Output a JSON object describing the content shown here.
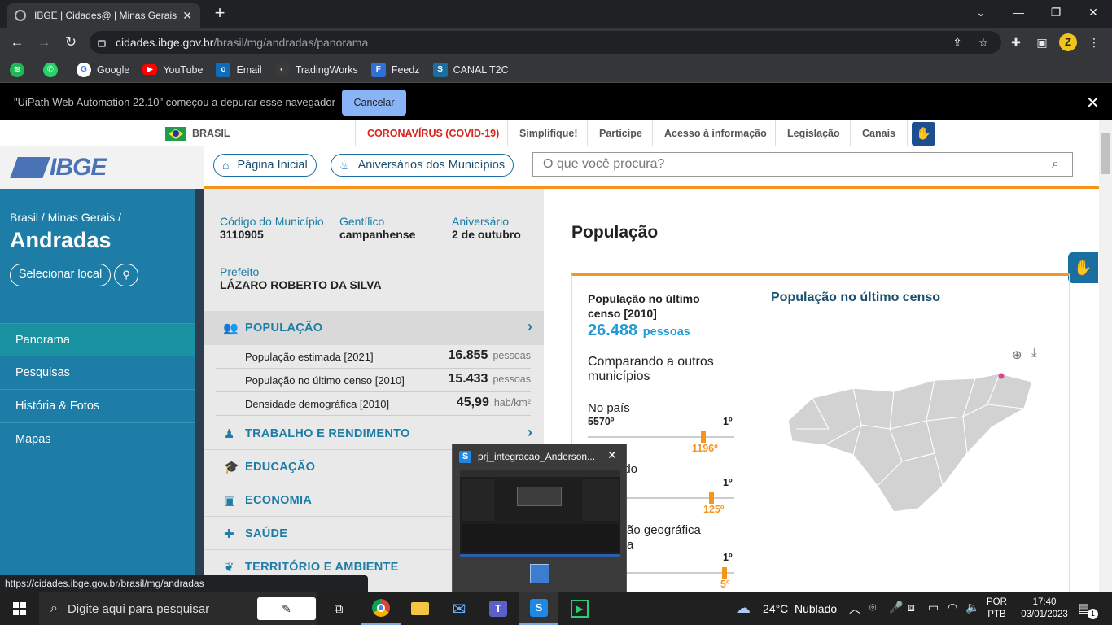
{
  "browser": {
    "tab_title": "IBGE | Cidades@ | Minas Gerais |",
    "tab_close": "✕",
    "new_tab": "+",
    "url_host": "cidades.ibge.gov.br",
    "url_path": "/brasil/mg/andradas/panorama",
    "profile_initial": "Z",
    "bookmarks": [
      "Google",
      "YouTube",
      "Email",
      "TradingWorks",
      "Feedz",
      "CANAL T2C"
    ],
    "infobar_message": "\"UiPath Web Automation 22.10\" começou a depurar esse navegador",
    "infobar_button": "Cancelar",
    "status_url": "https://cidades.ibge.gov.br/brasil/mg/andradas"
  },
  "govbar": {
    "brasil": "BRASIL",
    "links": [
      "CORONAVÍRUS (COVID-19)",
      "Simplifique!",
      "Participe",
      "Acesso à informação",
      "Legislação",
      "Canais"
    ]
  },
  "header": {
    "logo": "IBGE",
    "home_label": "Página Inicial",
    "anniv_label": "Aniversários dos Municípios",
    "search_placeholder": "O que você procura?"
  },
  "sidebar": {
    "breadcrumb": "Brasil / Minas Gerais /",
    "city": "Andradas",
    "select_label": "Selecionar local",
    "nav": [
      "Panorama",
      "Pesquisas",
      "História & Fotos",
      "Mapas"
    ]
  },
  "info": {
    "codigo_label": "Código do Município",
    "codigo_value": "3110905",
    "gentilico_label": "Gentílico",
    "gentilico_value": "campanhense",
    "aniversario_label": "Aniversário",
    "aniversario_value": "2 de outubro",
    "prefeito_label": "Prefeito",
    "prefeito_value": "LÁZARO ROBERTO DA SILVA"
  },
  "population_section": {
    "title": "POPULAÇÃO",
    "rows": [
      {
        "label": "População estimada [2021]",
        "value": "16.855",
        "unit": "pessoas"
      },
      {
        "label": "População no último censo [2010]",
        "value": "15.433",
        "unit": "pessoas"
      },
      {
        "label": "Densidade demográfica [2010]",
        "value": "45,99",
        "unit": "hab/km²"
      }
    ]
  },
  "categories": [
    "TRABALHO E RENDIMENTO",
    "EDUCAÇÃO",
    "ECONOMIA",
    "SAÚDE",
    "TERRITÓRIO E AMBIENTE"
  ],
  "content": {
    "title": "População",
    "card_label": "População no último censo [2010]",
    "card_value": "26.488",
    "card_unit": "pessoas",
    "compare_title": "Comparando a outros municípios",
    "pais_label": "No país",
    "pais_min": "5570º",
    "pais_max": "1º",
    "pais_rank": "1196º",
    "estado_label": "ado",
    "estado_max": "1º",
    "estado_rank": "125º",
    "regiao_label": "ão geográfica",
    "regiao_label2": "a",
    "regiao_max": "1º",
    "regiao_rank": "5º",
    "map_title": "População no último censo"
  },
  "floating": {
    "title": "prj_integracao_Anderson..."
  },
  "taskbar": {
    "search_placeholder": "Digite aqui para pesquisar",
    "weather_temp": "24°C",
    "weather_desc": "Nublado",
    "lang1": "POR",
    "lang2": "PTB",
    "time": "17:40",
    "date": "03/01/2023",
    "notif_count": "1"
  },
  "colors": {
    "accent_orange": "#f7941d",
    "ibge_blue": "#1e7da6",
    "covid_red": "#d9261c"
  }
}
